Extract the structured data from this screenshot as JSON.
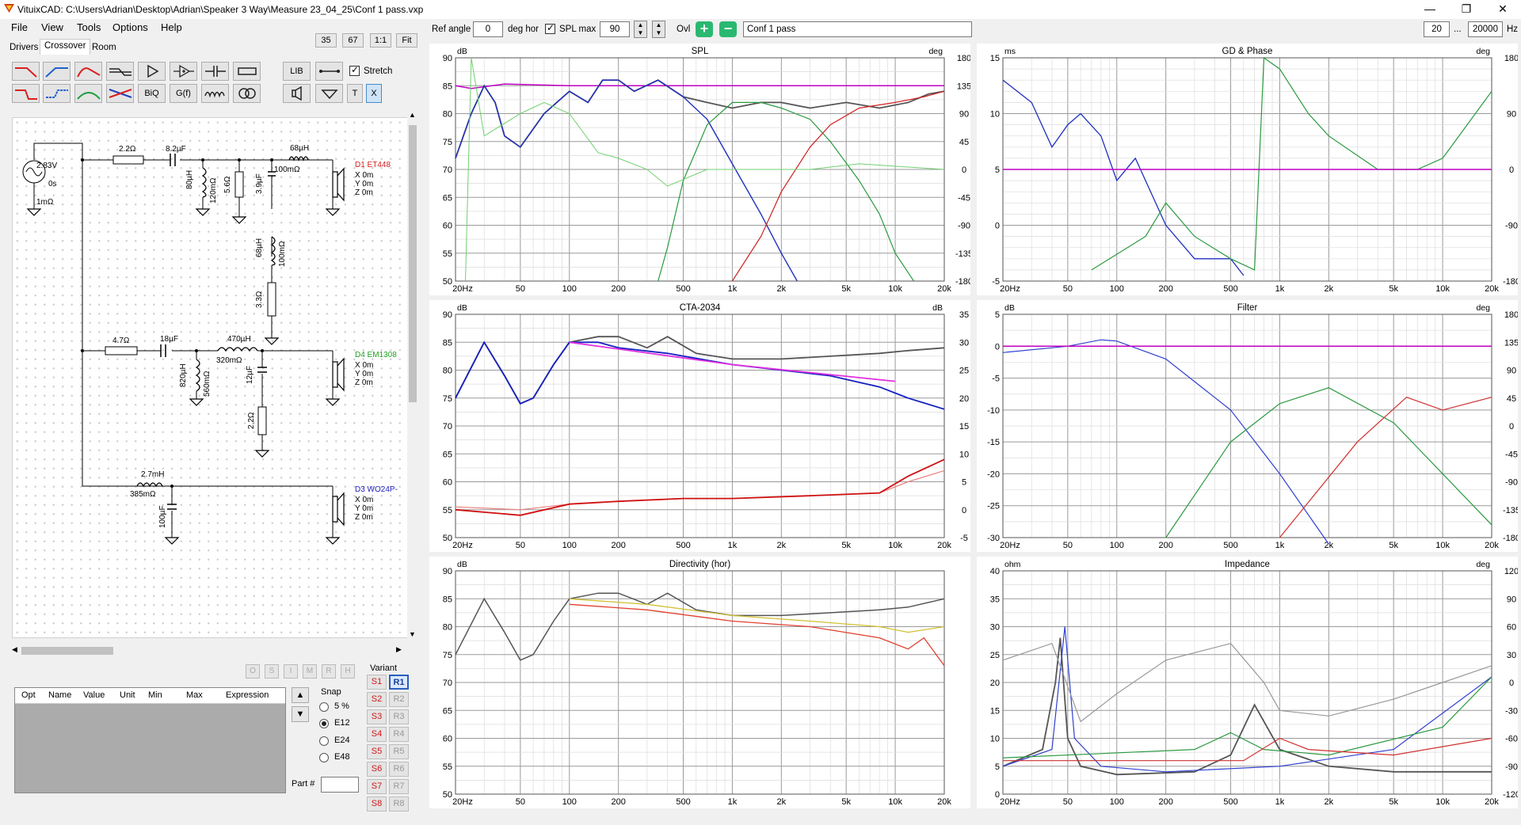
{
  "window": {
    "title": "VituixCAD: C:\\Users\\Adrian\\Desktop\\Adrian\\Speaker 3 Way\\Measure 23_04_25\\Conf 1 pass.vxp"
  },
  "menu": [
    "File",
    "View",
    "Tools",
    "Options",
    "Help"
  ],
  "tabs": [
    "Drivers",
    "Crossover",
    "Room"
  ],
  "zoom_buttons": [
    "35",
    "67",
    "1:1",
    "Fit"
  ],
  "toolbar": {
    "lib": "LIB",
    "biq": "BiQ",
    "gf": "G(f)",
    "t": "T",
    "x": "X",
    "stretch_label": "Stretch",
    "stretch_checked": true
  },
  "top_controls": {
    "ref_angle_label": "Ref angle",
    "ref_angle": "0",
    "deg_hor": "deg hor",
    "spl_max_label": "SPL max",
    "spl_max": "90",
    "ovl": "Ovl",
    "overlay_name": "Conf 1 pass",
    "freq_min": "20",
    "ellipsis": "...",
    "freq_max": "20000",
    "hz": "Hz"
  },
  "schematic": {
    "source": {
      "voltage": "2.83V",
      "delay": "0s",
      "impedance": "1mΩ"
    },
    "components": {
      "r1": "2.2Ω",
      "c1": "8.2µF",
      "l1": "80µH",
      "l1r": "120mΩ",
      "r2": "5.6Ω",
      "l2": "68µH",
      "l2r": "100mΩ",
      "c2": "3.9µF",
      "l3": "68µH",
      "l3r": "100mΩ",
      "r3": "3.3Ω",
      "r4": "4.7Ω",
      "c3": "18µF",
      "l4": "470µH",
      "l4r": "320mΩ",
      "l5": "820µH",
      "l5r": "560mΩ",
      "c4": "12µF",
      "r5": "2.2Ω",
      "l6": "2.7mH",
      "l6r": "385mΩ",
      "c5": "100µF"
    },
    "drivers": [
      {
        "name": "D1 ET448",
        "x": "X 0m",
        "y": "Y 0m",
        "z": "Z 0m",
        "color": "#d02020"
      },
      {
        "name": "D4 EM1308",
        "x": "X 0m",
        "y": "Y 0m",
        "z": "Z 0m",
        "color": "#20a020"
      },
      {
        "name": "D3 WO24P-",
        "x": "X 0m",
        "y": "Y 0m",
        "z": "Z 0m",
        "color": "#2020c0"
      }
    ]
  },
  "optimizer_buttons": [
    "O",
    "S",
    "I",
    "M",
    "R",
    "H"
  ],
  "param_table": {
    "headers": [
      "Opt",
      "Name",
      "Value",
      "Unit",
      "Min",
      "Max",
      "Expression"
    ]
  },
  "snap": {
    "label": "Snap",
    "options": [
      "5 %",
      "E12",
      "E24",
      "E48"
    ],
    "selected": "E12"
  },
  "part_label": "Part #",
  "variant": {
    "label": "Variant",
    "s": [
      "S1",
      "S2",
      "S3",
      "S4",
      "S5",
      "S6",
      "S7",
      "S8"
    ],
    "r": [
      "R1",
      "R2",
      "R3",
      "R4",
      "R5",
      "R6",
      "R7",
      "R8"
    ],
    "active": "R1"
  },
  "charts": {
    "spl": {
      "title": "SPL",
      "left_unit": "dB",
      "right_unit": "deg",
      "left_ticks": [
        "90",
        "85",
        "80",
        "75",
        "70",
        "65",
        "60",
        "55",
        "50"
      ],
      "right_ticks": [
        "180",
        "135",
        "90",
        "45",
        "0",
        "-45",
        "-90",
        "-135",
        "-180"
      ]
    },
    "cta": {
      "title": "CTA-2034",
      "left_unit": "dB",
      "right_unit": "dB",
      "left_ticks": [
        "90",
        "85",
        "80",
        "75",
        "70",
        "65",
        "60",
        "55",
        "50"
      ],
      "right_ticks": [
        "35",
        "30",
        "25",
        "20",
        "15",
        "10",
        "5",
        "0",
        "-5"
      ]
    },
    "dir": {
      "title": "Directivity (hor)",
      "left_unit": "dB",
      "left_ticks": [
        "90",
        "85",
        "80",
        "75",
        "70",
        "65",
        "60",
        "55",
        "50"
      ]
    },
    "gd": {
      "title": "GD & Phase",
      "left_unit": "ms",
      "right_unit": "deg",
      "left_ticks": [
        "15",
        "10",
        "5",
        "0",
        "-5"
      ],
      "right_ticks": [
        "180",
        "90",
        "0",
        "-90",
        "-180"
      ]
    },
    "filter": {
      "title": "Filter",
      "left_unit": "dB",
      "right_unit": "deg",
      "left_ticks": [
        "5",
        "0",
        "-5",
        "-10",
        "-15",
        "-20",
        "-25",
        "-30"
      ],
      "right_ticks": [
        "180",
        "135",
        "90",
        "45",
        "0",
        "-45",
        "-90",
        "-135",
        "-180"
      ]
    },
    "imp": {
      "title": "Impedance",
      "left_unit": "ohm",
      "right_unit": "deg",
      "left_ticks": [
        "40",
        "35",
        "30",
        "25",
        "20",
        "15",
        "10",
        "5",
        "0"
      ],
      "right_ticks": [
        "120",
        "90",
        "60",
        "30",
        "0",
        "-30",
        "-60",
        "-90",
        "-120"
      ]
    },
    "freq_ticks": [
      "20Hz",
      "50",
      "100",
      "200",
      "500",
      "1k",
      "2k",
      "5k",
      "10k",
      "20k"
    ]
  }
}
